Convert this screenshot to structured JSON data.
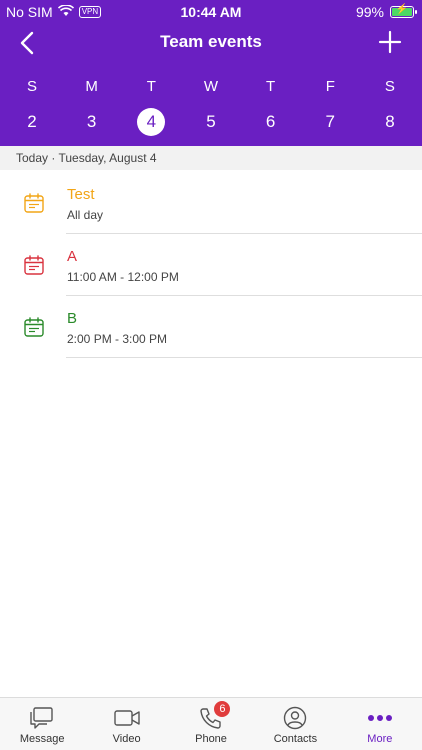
{
  "status": {
    "carrier": "No SIM",
    "vpn": "VPN",
    "time": "10:44 AM",
    "battery": "99%"
  },
  "nav": {
    "title": "Team events",
    "back_icon": "chevron-left-icon",
    "add_icon": "plus-icon"
  },
  "week": {
    "days": [
      "S",
      "M",
      "T",
      "W",
      "T",
      "F",
      "S"
    ],
    "dates": [
      "2",
      "3",
      "4",
      "5",
      "6",
      "7",
      "8"
    ],
    "selected": "4"
  },
  "today_label": "Today · Tuesday, August 4",
  "events": [
    {
      "name": "Test",
      "time": "All day",
      "color": "#f2a516"
    },
    {
      "name": "A",
      "time": "11:00 AM - 12:00 PM",
      "color": "#d9333f"
    },
    {
      "name": "B",
      "time": "2:00 PM - 3:00 PM",
      "color": "#2a8a2a"
    }
  ],
  "tabs": [
    {
      "label": "Message",
      "icon": "chat-bubbles-icon"
    },
    {
      "label": "Video",
      "icon": "video-camera-icon"
    },
    {
      "label": "Phone",
      "icon": "phone-icon",
      "badge": "6"
    },
    {
      "label": "Contacts",
      "icon": "person-circle-icon"
    },
    {
      "label": "More",
      "icon": "more-dots-icon",
      "active": true
    }
  ],
  "colors": {
    "brand": "#6a1fc2",
    "badge": "#e03c3c"
  }
}
